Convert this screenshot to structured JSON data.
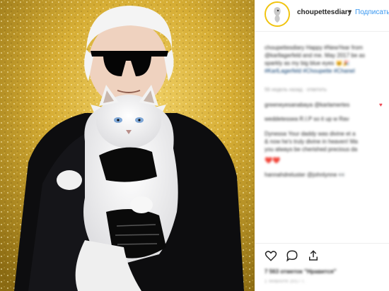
{
  "post": {
    "username": "choupettesdiary",
    "separator": "•",
    "follow_label": "Подписатьс",
    "caption": {
      "lines": [
        "choupettesdiary Happy #NewYear from",
        "@karllagerfeld and me. May 2017 be as",
        "sparkly as my big blue eyes 🐱🎉",
        "#KarlLagerfeld #Choupette #Chanel"
      ],
      "time": "56 недель назад · ответить"
    },
    "comments": [
      {
        "text": "greeneyesanabaya @karlamertes"
      },
      {
        "text": "weddetessea R.I.P so it up w Rav"
      },
      {
        "text": "Dynessa Your daddy was divine et a"
      },
      {
        "text": "& now he's truly divine in heaven! Ma"
      },
      {
        "text": "you always be cherished precious da"
      },
      {
        "text": "❤️❤️"
      },
      {
        "text": "hannahdreluster @johnlynne 👀"
      }
    ],
    "likes": "7 563 отметок \"Нравится\"",
    "date": "1 ЯНВАРЯ 2017 Г."
  },
  "icons": {
    "like": "heart-outline-icon",
    "comment": "comment-bubble-icon",
    "share": "share-arrow-icon",
    "avatar": "cat-avatar-icon"
  },
  "colors": {
    "link_blue": "#3897f0",
    "like_red": "#ed4956",
    "gold_background": "#c9a227"
  }
}
